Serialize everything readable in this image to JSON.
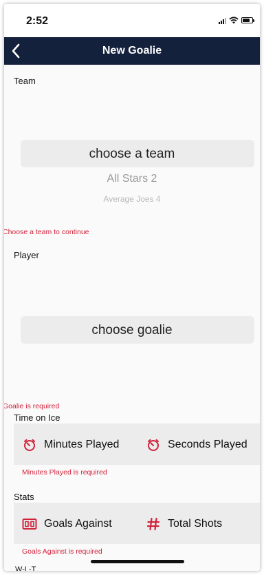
{
  "status_bar": {
    "time": "2:52"
  },
  "nav": {
    "title": "New Goalie",
    "back_icon": "chevron-left-icon"
  },
  "team": {
    "label": "Team",
    "selected": "choose a team",
    "options": [
      "All Stars 2",
      "Average Joes 4"
    ],
    "error": "Choose a team to continue"
  },
  "player": {
    "label": "Player",
    "selected": "choose goalie",
    "error": "Goalie is required"
  },
  "time_on_ice": {
    "label": "Time on Ice",
    "minutes_label": "Minutes Played",
    "seconds_label": "Seconds Played",
    "icon": "timer-icon",
    "error": "Minutes Played is required"
  },
  "stats": {
    "label": "Stats",
    "goals_against_label": "Goals Against",
    "goals_against_icon": "scoreboard-icon",
    "total_shots_label": "Total Shots",
    "total_shots_icon": "hash-icon",
    "error": "Goals Against is required"
  },
  "wlt": {
    "label": "W-L-T"
  },
  "colors": {
    "nav_bg": "#14213d",
    "accent_red": "#d0233b",
    "field_bg": "#ececec"
  }
}
